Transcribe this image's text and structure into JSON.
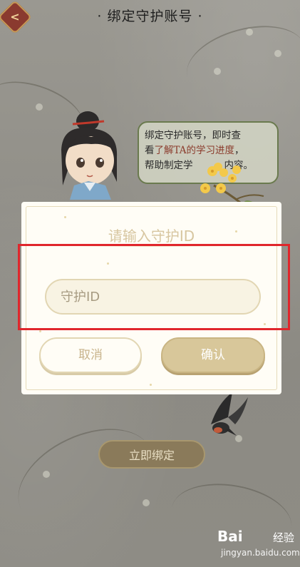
{
  "header": {
    "title": "· 绑定守护账号 ·",
    "back_icon": "back-arrow-icon"
  },
  "intro": {
    "line1": "绑定守护账号，即时查",
    "line2_prefix": "看",
    "line2_highlight": "了解TA的学习进度",
    "line2_suffix": "，",
    "line3": "帮助制定学",
    "line3_tail": "内容。"
  },
  "page_button": {
    "bind_now": "立即绑定"
  },
  "dialog": {
    "title": "请输入守护ID",
    "input_placeholder": "守护ID",
    "cancel": "取消",
    "confirm": "确认"
  },
  "watermark": {
    "logo": "Bai",
    "brand": "经验",
    "url": "jingyan.baidu.com"
  },
  "colors": {
    "highlight_box": "#e0262c",
    "confirm_bg": "#d8c79a",
    "accent_text": "#8b3b2c"
  }
}
